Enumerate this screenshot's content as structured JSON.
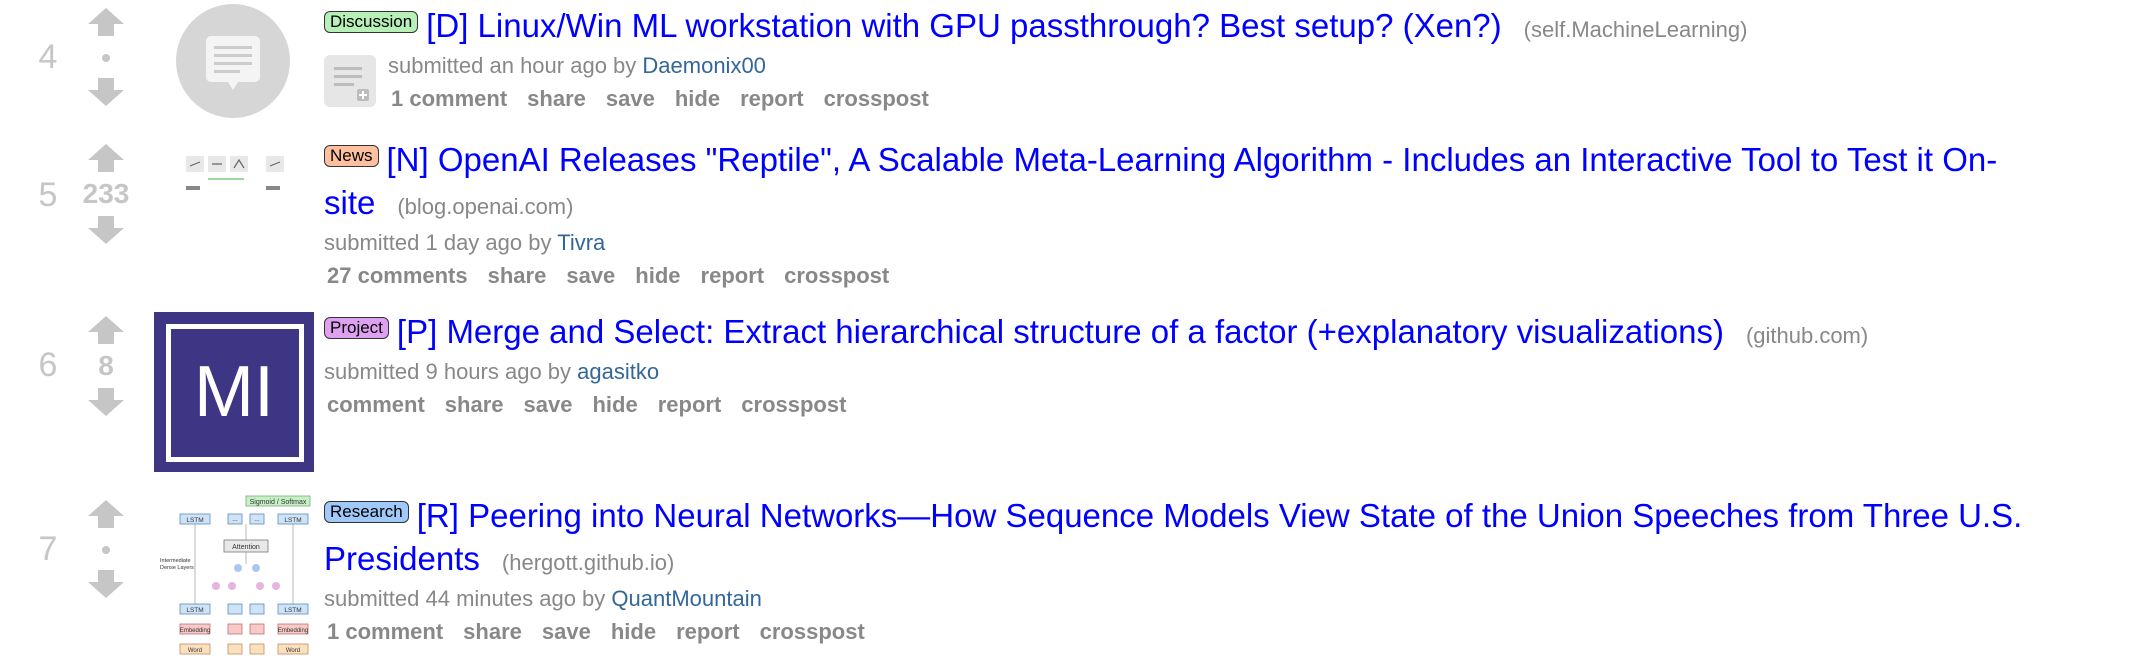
{
  "posts": [
    {
      "rank": "4",
      "score": "",
      "flair": "Discussion",
      "flair_color": "#b6f0b6",
      "title": "[D] Linux/Win ML workstation with GPU passthrough? Best setup? (Xen?)",
      "domain": "(self.MachineLearning)",
      "tagline_pre": "submitted an hour ago by",
      "author": "Daemonix00",
      "comments": "1 comment",
      "actions": [
        "share",
        "save",
        "hide",
        "report",
        "crosspost"
      ]
    },
    {
      "rank": "5",
      "score": "233",
      "flair": "News",
      "flair_color": "#ffc0a0",
      "title": "[N] OpenAI Releases \"Reptile\", A Scalable Meta-Learning Algorithm - Includes an Interactive Tool to Test it On-site",
      "domain": "(blog.openai.com)",
      "tagline_pre": "submitted 1 day ago by",
      "author": "Tivra",
      "comments": "27 comments",
      "actions": [
        "share",
        "save",
        "hide",
        "report",
        "crosspost"
      ]
    },
    {
      "rank": "6",
      "score": "8",
      "flair": "Project",
      "flair_color": "#e0a0f0",
      "title": "[P] Merge and Select: Extract hierarchical structure of a factor (+explanatory visualizations)",
      "domain": "(github.com)",
      "tagline_pre": "submitted 9 hours ago by",
      "author": "agasitko",
      "comments": "comment",
      "actions": [
        "share",
        "save",
        "hide",
        "report",
        "crosspost"
      ],
      "thumb_text": "MI"
    },
    {
      "rank": "7",
      "score": "",
      "flair": "Research",
      "flair_color": "#a0c8f8",
      "title": "[R] Peering into Neural Networks—How Sequence Models View State of the Union Speeches from Three U.S. Presidents",
      "domain": "(hergott.github.io)",
      "tagline_pre": "submitted 44 minutes ago by",
      "author": "QuantMountain",
      "comments": "1 comment",
      "actions": [
        "share",
        "save",
        "hide",
        "report",
        "crosspost"
      ],
      "diagram": {
        "top": "Sigmoid / Softmax",
        "lstm": "LSTM",
        "ellipsis": "...",
        "attention": "Attention",
        "dense_1": "Intermediate",
        "dense_2": "Dense Layers",
        "embedding": "Embedding",
        "word": "Word"
      }
    }
  ],
  "colors": {
    "link": "#0000ff",
    "author": "#336699",
    "muted": "#888888",
    "arrow": "#c6c6c6",
    "mi_bg": "#3f3585"
  }
}
